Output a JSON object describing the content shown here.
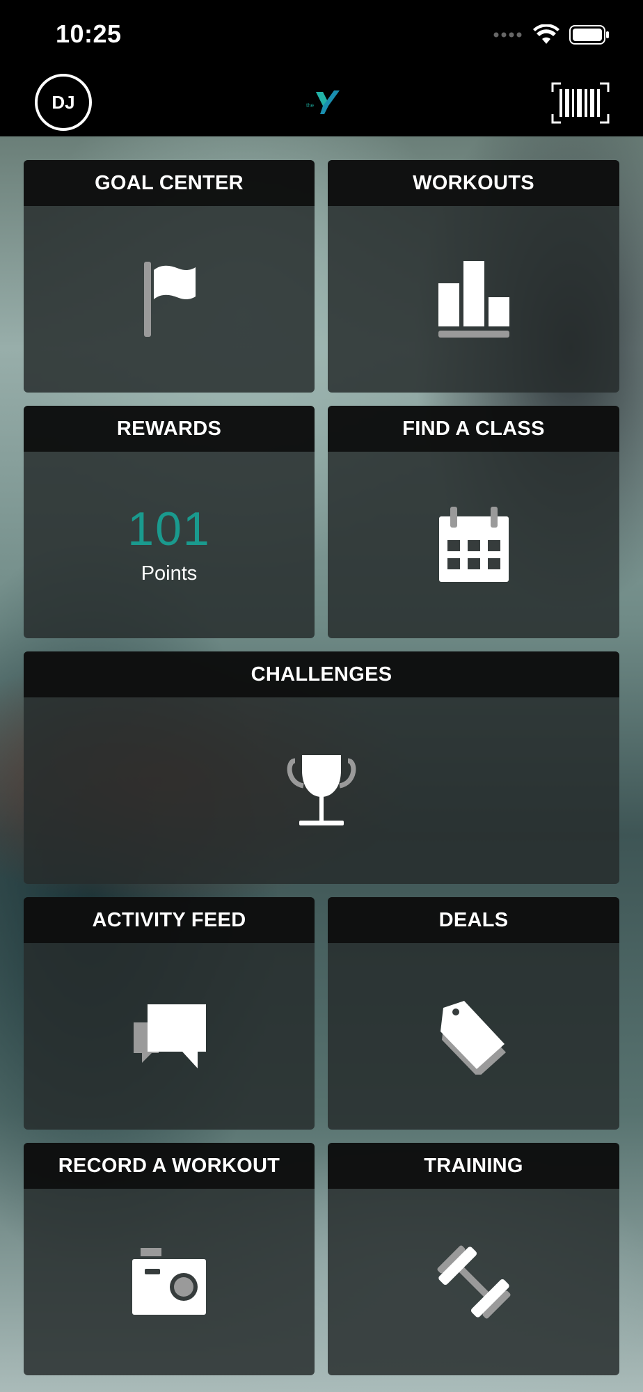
{
  "status_bar": {
    "time": "10:25",
    "icons": [
      "signal-icon",
      "wifi-icon",
      "battery-icon"
    ]
  },
  "header": {
    "avatar_initials": "DJ",
    "logo_text": "the",
    "logo_icon": "ymca-y-logo",
    "barcode_icon": "barcode-icon"
  },
  "colors": {
    "accent": "#1a9a8e",
    "header_bg": "#000000",
    "tile_header_bg": "#0b0c0c",
    "tile_bg": "#262c2c"
  },
  "tiles": {
    "goal_center": {
      "title": "GOAL CENTER",
      "icon": "flag-icon"
    },
    "workouts": {
      "title": "WORKOUTS",
      "icon": "bar-chart-icon"
    },
    "rewards": {
      "title": "REWARDS",
      "points_value": "101",
      "points_label": "Points"
    },
    "find_a_class": {
      "title": "FIND A CLASS",
      "icon": "calendar-icon"
    },
    "challenges": {
      "title": "CHALLENGES",
      "icon": "trophy-icon"
    },
    "activity_feed": {
      "title": "ACTIVITY FEED",
      "icon": "chat-bubbles-icon"
    },
    "deals": {
      "title": "DEALS",
      "icon": "price-tag-icon"
    },
    "record_a_workout": {
      "title": "RECORD A WORKOUT",
      "icon": "camera-icon"
    },
    "training": {
      "title": "TRAINING",
      "icon": "dumbbell-icon"
    }
  }
}
